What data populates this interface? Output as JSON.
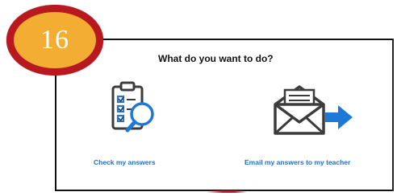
{
  "step_badge": {
    "number": "16"
  },
  "dialog": {
    "question": "What do you want to do?",
    "options": [
      {
        "label": "Check my answers",
        "icon": "clipboard-magnifier-icon"
      },
      {
        "label": "Email my answers to my teacher",
        "icon": "envelope-arrow-icon"
      }
    ]
  },
  "colors": {
    "badge_ring": "#b8181e",
    "badge_fill": "#f2ad32",
    "link_text": "#1e6fd0",
    "icon_blue": "#1e78d7",
    "icon_dark": "#3c3c3c"
  }
}
